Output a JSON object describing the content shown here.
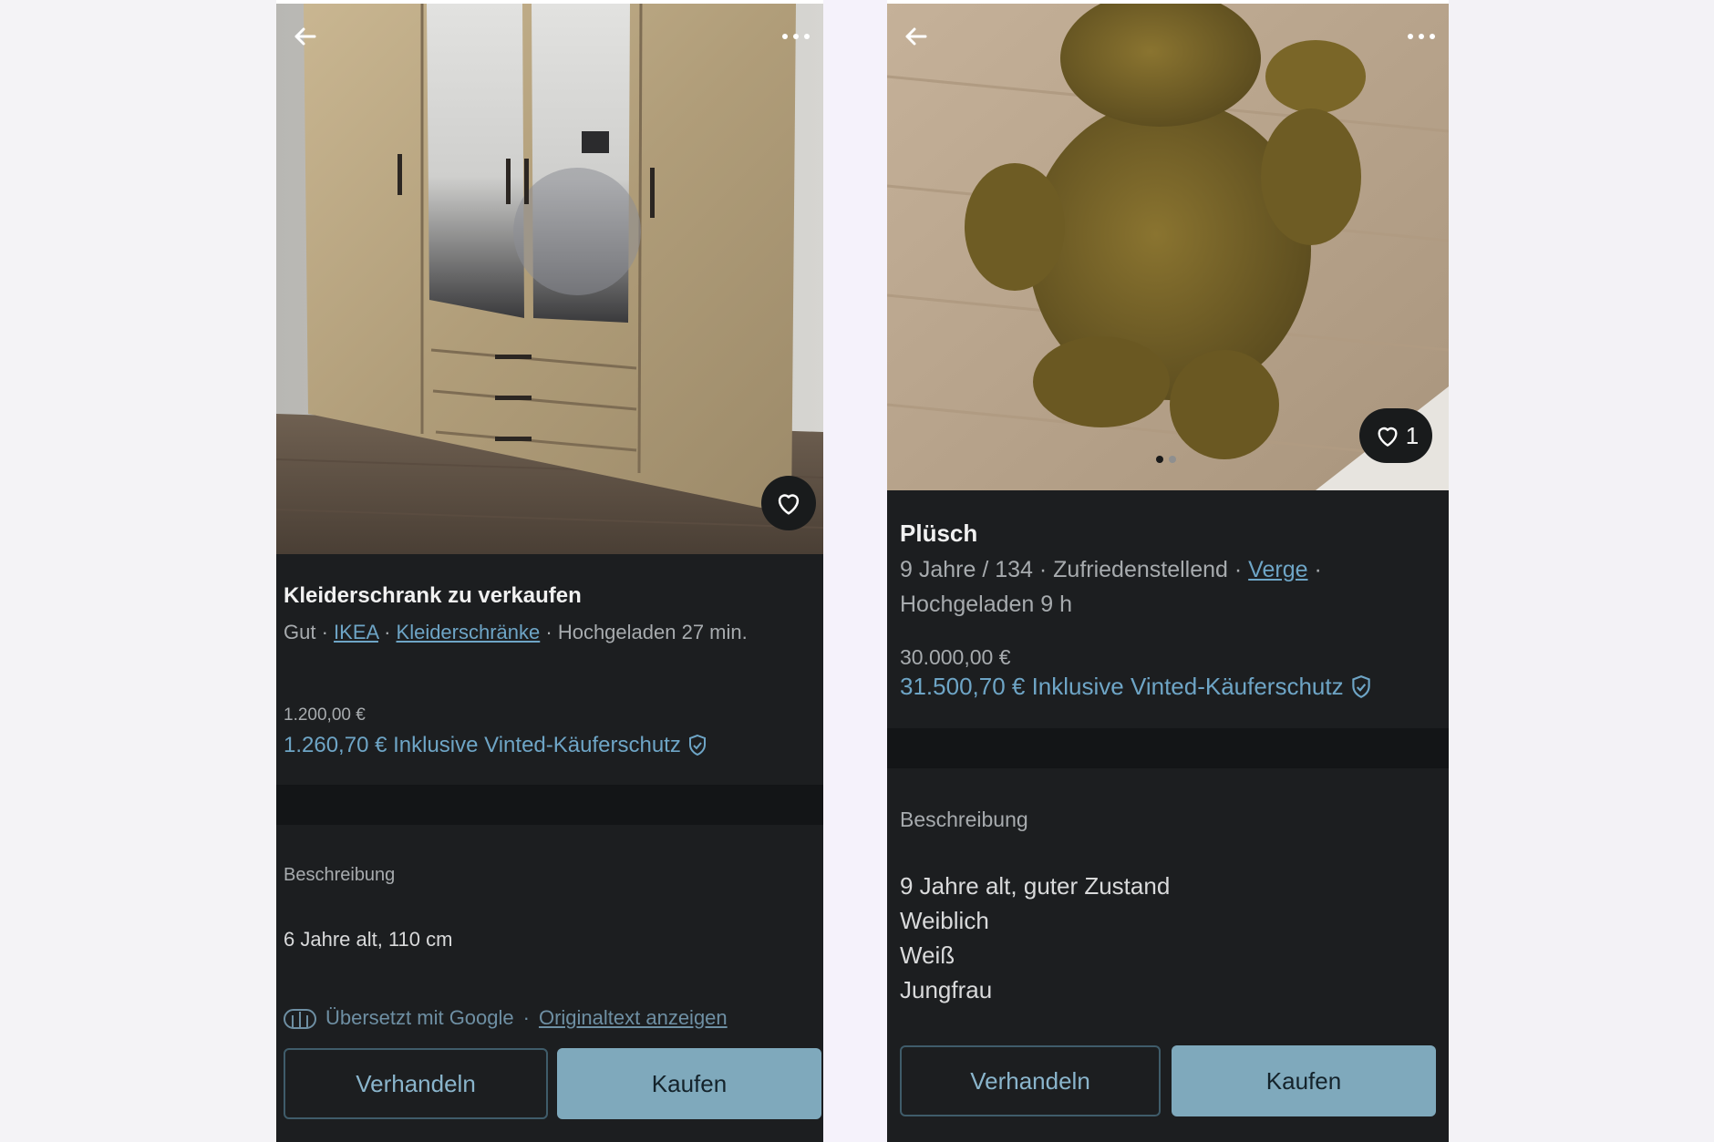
{
  "listings": [
    {
      "title": "Kleiderschrank zu verkaufen",
      "condition": "Gut",
      "brand": "IKEA",
      "category": "Kleiderschränke",
      "uploaded": "Hochgeladen 27 min.",
      "price": "1.200,00 €",
      "total_price": "1.260,70 € Inklusive Vinted-Käuferschutz",
      "description_label": "Beschreibung",
      "description_lines": [
        "6 Jahre alt, 110 cm"
      ],
      "translated_text": "Übersetzt mit Google",
      "original_link": "Originaltext anzeigen",
      "negotiate_label": "Verhandeln",
      "buy_label": "Kaufen"
    },
    {
      "title": "Plüsch",
      "meta_prefix": "9 Jahre / 134 · Zufriedenstellend ·",
      "brand": "Verge",
      "uploaded": "Hochgeladen 9 h",
      "price": "30.000,00 €",
      "total_price": "31.500,70 € Inklusive Vinted-Käuferschutz",
      "favorite_count": "1",
      "photo_count": 2,
      "photo_index": 1,
      "description_label": "Beschreibung",
      "description_lines": [
        "9 Jahre alt, guter Zustand",
        "Weiblich",
        "Weiß",
        "Jungfrau"
      ],
      "negotiate_label": "Verhandeln",
      "buy_label": "Kaufen"
    }
  ],
  "icons": {
    "back": "arrow-left-icon",
    "more": "more-dots-icon",
    "favorite": "heart-icon",
    "protection": "shield-check-icon",
    "translate": "google-translate-icon"
  },
  "colors": {
    "background": "#1c1e20",
    "accent": "#6ea5c6",
    "primary_button": "#7fa9bc"
  }
}
